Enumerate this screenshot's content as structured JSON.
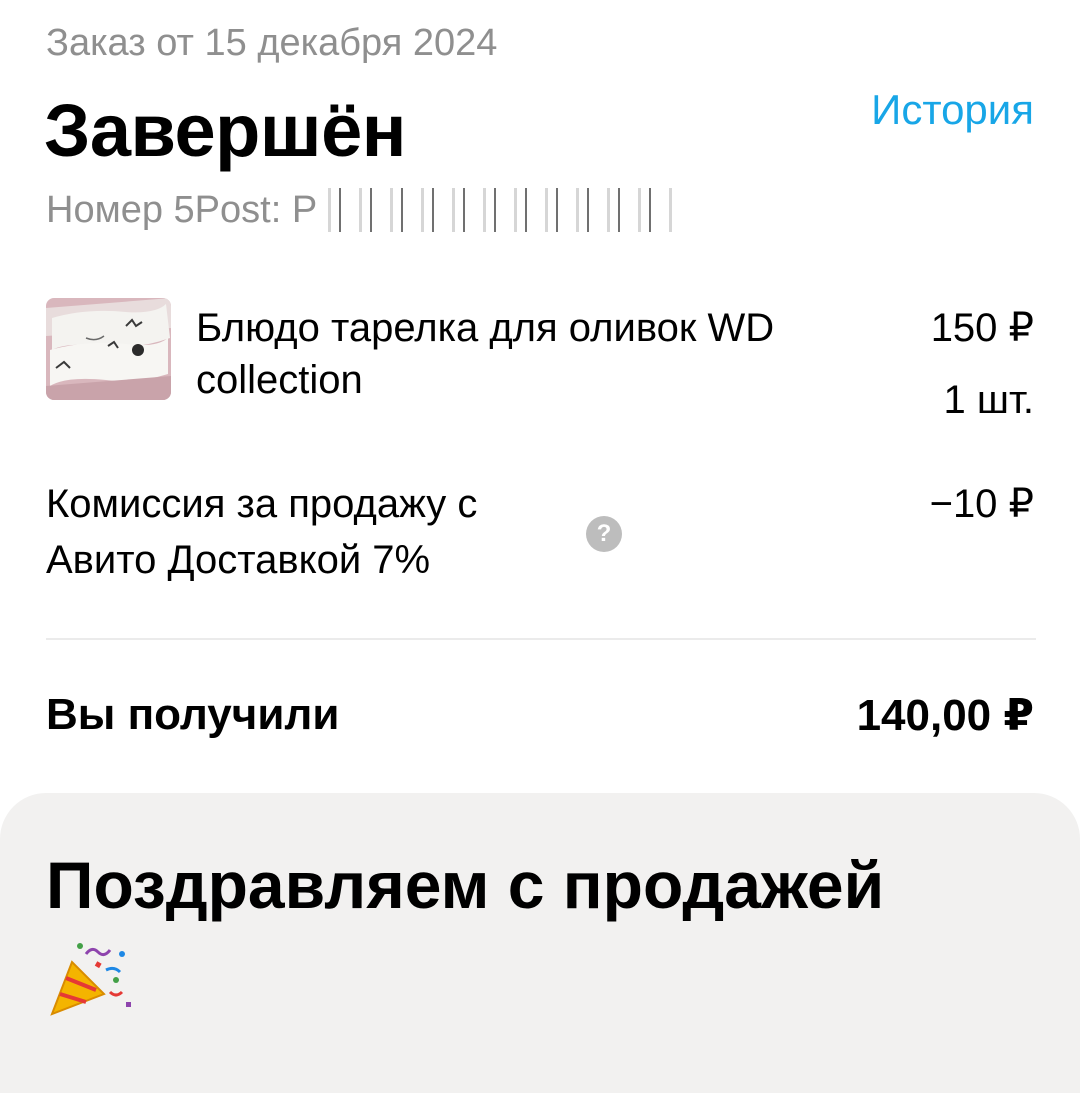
{
  "order": {
    "date_label": "Заказ от 15 декабря 2024",
    "status": "Завершён",
    "history_link": "История",
    "tracking_label": "Номер 5Post: P"
  },
  "product": {
    "title": "Блюдо тарелка для оливок WD collection",
    "price": "150 ₽",
    "quantity": "1 шт.",
    "thumb_icon": "product-photo"
  },
  "fee": {
    "label": "Комиссия за продажу с Авито Доставкой 7%",
    "amount": "−10 ₽",
    "help_symbol": "?"
  },
  "total": {
    "label": "Вы получили",
    "amount": "140,00 ₽"
  },
  "congrats": {
    "title": "Поздравляем с продажей",
    "icon": "party-popper-icon"
  },
  "colors": {
    "accent": "#18a6e7",
    "muted_text": "#8f8f8f",
    "card_bg": "#f2f1f0"
  }
}
